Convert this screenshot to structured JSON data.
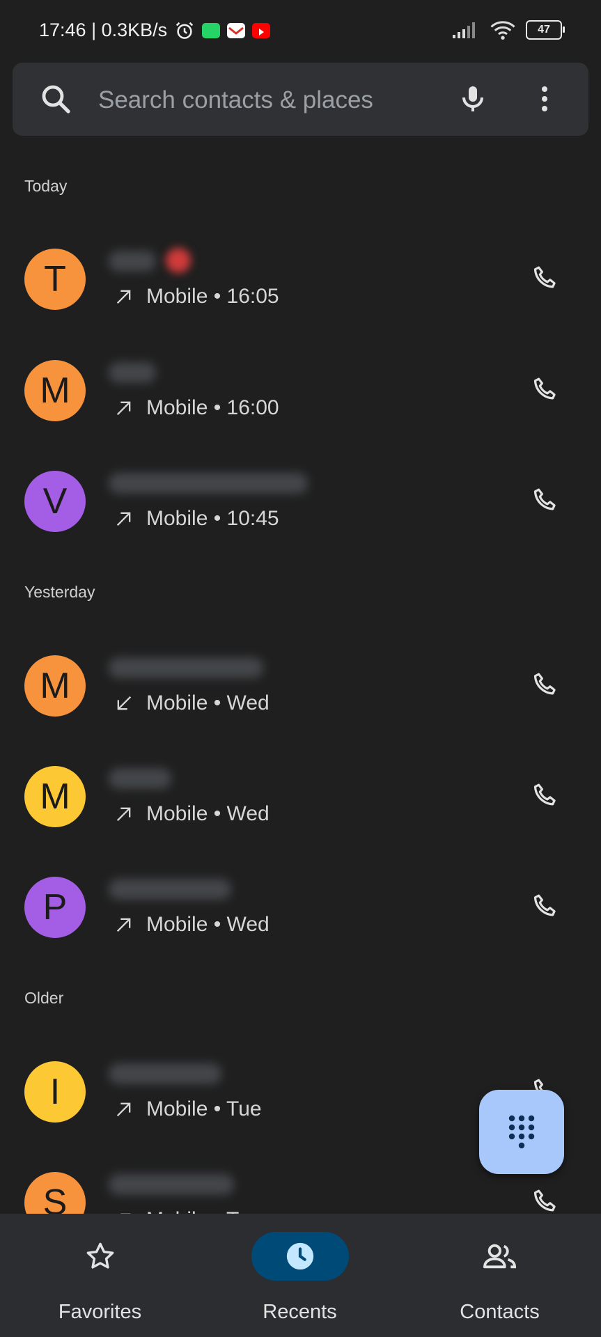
{
  "status_bar": {
    "time_speed": "17:46 | 0.3KB/s",
    "battery": "47"
  },
  "search": {
    "placeholder": "Search contacts & places"
  },
  "sections": {
    "today": "Today",
    "yesterday": "Yesterday",
    "older": "Older"
  },
  "calls": [
    {
      "initial": "T",
      "color": "#f7923d",
      "direction": "outgoing",
      "detail": "Mobile • 16:05"
    },
    {
      "initial": "M",
      "color": "#f7923d",
      "direction": "outgoing",
      "detail": "Mobile • 16:00"
    },
    {
      "initial": "V",
      "color": "#a45ee5",
      "direction": "outgoing",
      "detail": "Mobile • 10:45"
    },
    {
      "initial": "M",
      "color": "#f7923d",
      "direction": "incoming",
      "detail": "Mobile • Wed"
    },
    {
      "initial": "M",
      "color": "#fcc934",
      "direction": "outgoing",
      "detail": "Mobile • Wed"
    },
    {
      "initial": "P",
      "color": "#a45ee5",
      "direction": "outgoing",
      "detail": "Mobile • Wed"
    },
    {
      "initial": "I",
      "color": "#fcc934",
      "direction": "outgoing",
      "detail": "Mobile • Tue"
    },
    {
      "initial": "S",
      "color": "#f7923d",
      "direction": "outgoing",
      "detail": "Mobile • Tue"
    }
  ],
  "nav": {
    "favorites": "Favorites",
    "recents": "Recents",
    "contacts": "Contacts"
  },
  "colors": {
    "background": "#1f1f1f",
    "fab": "#a8c7fa",
    "active_nav": "#004a77"
  }
}
